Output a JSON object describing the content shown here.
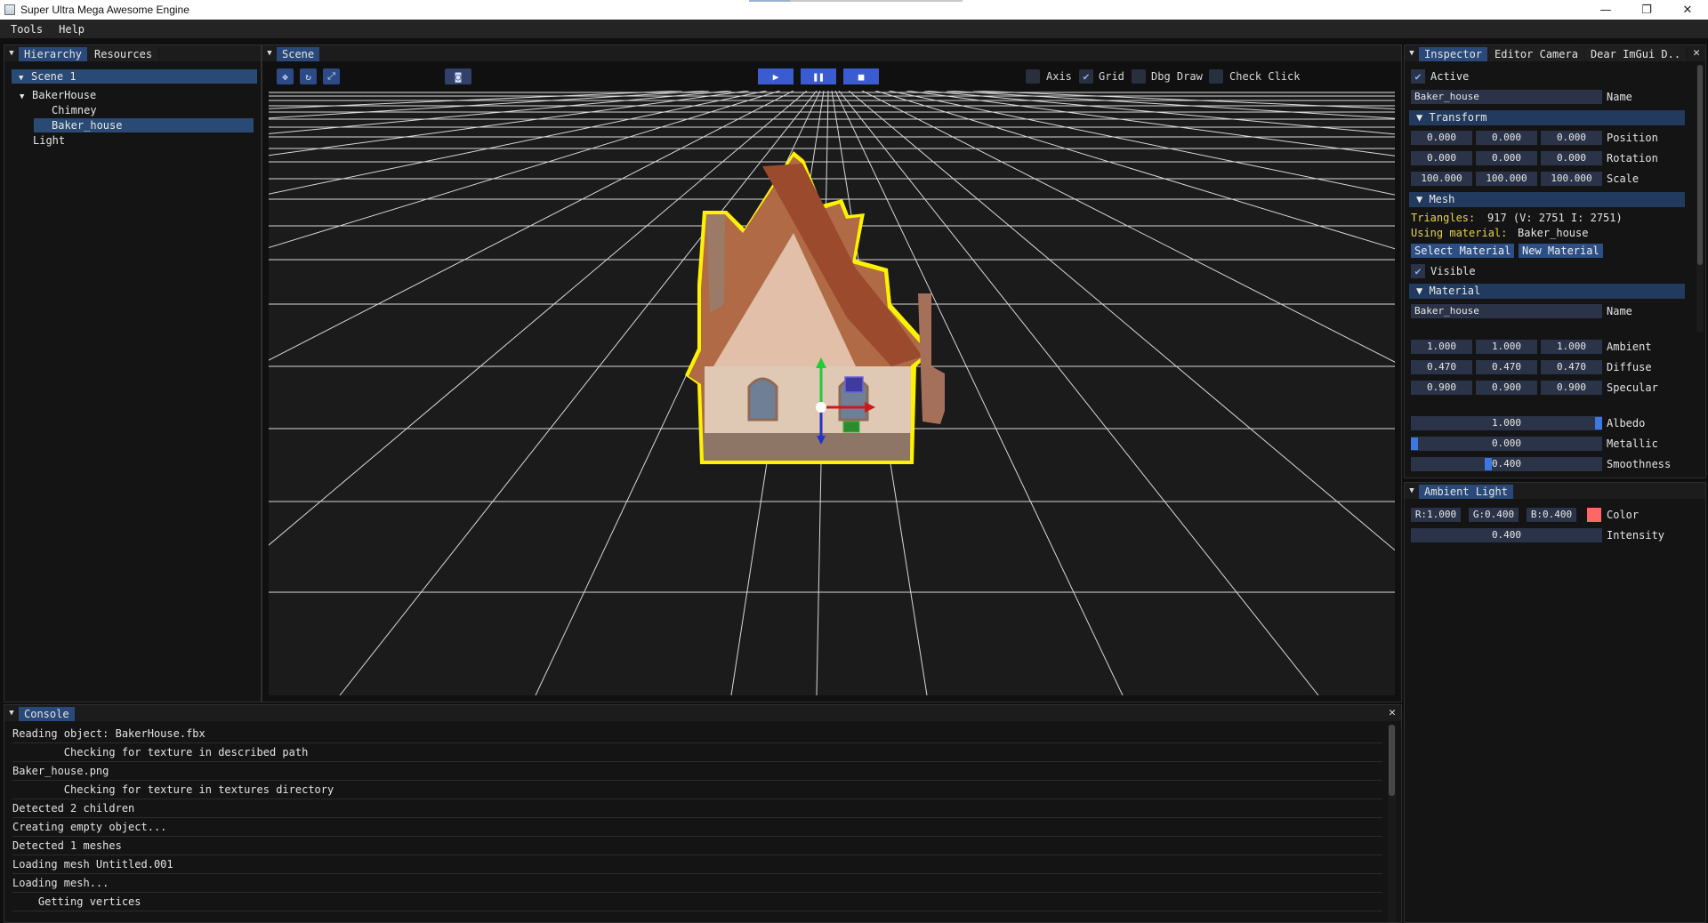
{
  "window": {
    "title": "Super Ultra Mega Awesome Engine",
    "minimize_glyph": "—",
    "maximize_glyph": "❐",
    "close_glyph": "✕"
  },
  "menu": [
    "Tools",
    "Help"
  ],
  "hierarchy": {
    "tabs": [
      "Hierarchy",
      "Resources"
    ],
    "scene": "Scene 1",
    "nodes": {
      "root": "BakerHouse",
      "child1": "Chimney",
      "child2": "Baker_house",
      "light": "Light"
    }
  },
  "scene_panel": {
    "tab": "Scene",
    "toggles": {
      "axis": {
        "label": "Axis",
        "checked": false
      },
      "grid": {
        "label": "Grid",
        "checked": true
      },
      "dbg_draw": {
        "label": "Dbg Draw",
        "checked": false
      },
      "check_click": {
        "label": "Check Click",
        "checked": false
      }
    }
  },
  "inspector": {
    "tabs": [
      "Inspector",
      "Editor Camera",
      "Dear ImGui D.."
    ],
    "active_label": "Active",
    "object_name": "Baker_house",
    "name_label": "Name",
    "transform": {
      "header": "Transform",
      "position": [
        "0.000",
        "0.000",
        "0.000"
      ],
      "position_label": "Position",
      "rotation": [
        "0.000",
        "0.000",
        "0.000"
      ],
      "rotation_label": "Rotation",
      "scale": [
        "100.000",
        "100.000",
        "100.000"
      ],
      "scale_label": "Scale"
    },
    "mesh": {
      "header": "Mesh",
      "triangles_label": "Triangles:",
      "triangles_value": "917  (V: 2751  I: 2751)",
      "material_label": "Using material:",
      "material_value": "Baker_house",
      "select_material": "Select Material",
      "new_material": "New Material",
      "visible_label": "Visible"
    },
    "material": {
      "header": "Material",
      "name": "Baker_house",
      "name_label": "Name",
      "ambient": [
        "1.000",
        "1.000",
        "1.000"
      ],
      "ambient_label": "Ambient",
      "diffuse": [
        "0.470",
        "0.470",
        "0.470"
      ],
      "diffuse_label": "Diffuse",
      "specular": [
        "0.900",
        "0.900",
        "0.900"
      ],
      "specular_label": "Specular",
      "albedo": "1.000",
      "albedo_fraction": 1.0,
      "albedo_label": "Albedo",
      "metallic": "0.000",
      "metallic_fraction": 0.0,
      "metallic_label": "Metallic",
      "smoothness": "0.400",
      "smoothness_fraction": 0.4,
      "smoothness_label": "Smoothness"
    }
  },
  "ambient_light": {
    "tab": "Ambient Light",
    "r": "R:1.000",
    "g": "G:0.400",
    "b": "B:0.400",
    "swatch": "#ff6666",
    "color_label": "Color",
    "intensity": "0.400",
    "intensity_label": "Intensity"
  },
  "console": {
    "tab": "Console",
    "close_glyph": "✕",
    "lines": [
      "Reading object: BakerHouse.fbx",
      "        Checking for texture in described path",
      "Baker_house.png",
      "        Checking for texture in textures directory",
      "Detected 2 children",
      "Creating empty object...",
      "Detected 1 meshes",
      "Loading mesh Untitled.001",
      "Loading mesh...",
      "    Getting vertices"
    ]
  }
}
